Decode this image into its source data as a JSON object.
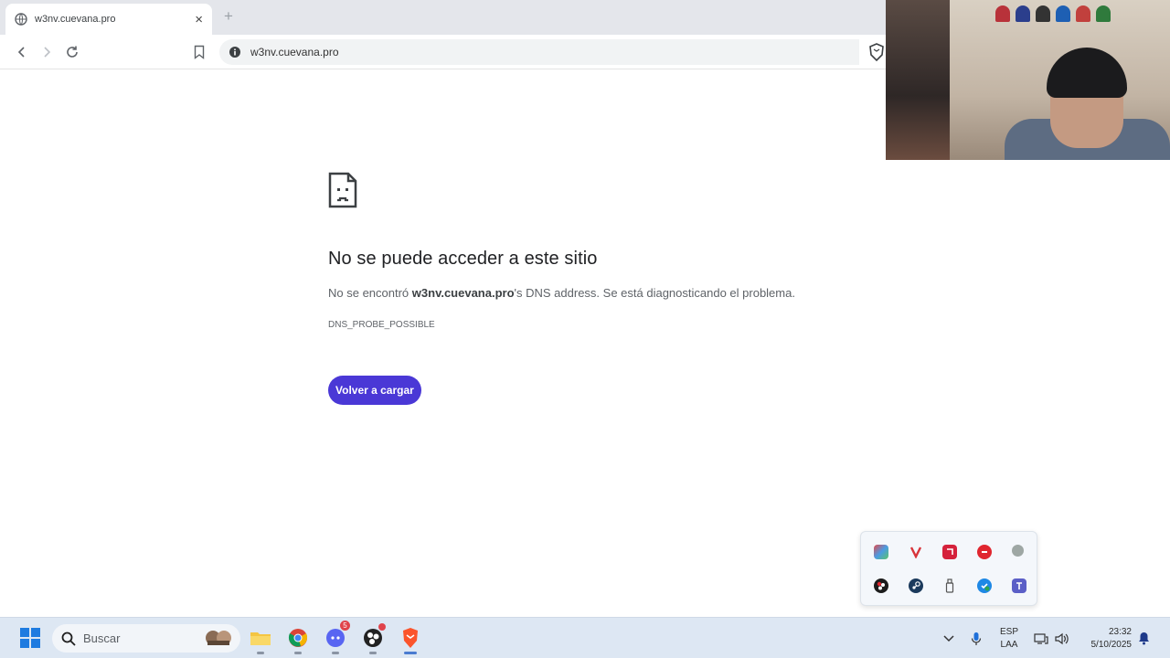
{
  "browser": {
    "tab": {
      "title": "w3nv.cuevana.pro",
      "close": "×"
    },
    "new_tab": "+",
    "address": {
      "url": "w3nv.cuevana.pro"
    }
  },
  "error_page": {
    "title": "No se puede acceder a este sitio",
    "desc_prefix": "No se encontró ",
    "desc_host": "w3nv.cuevana.pro",
    "desc_suffix": "'s DNS address. Se está diagnosticando el problema.",
    "code": "DNS_PROBE_POSSIBLE",
    "reload_label": "Volver a cargar"
  },
  "tray_popup": {
    "icons": [
      "nvidia-broadcast-icon",
      "vivaldi-icon",
      "amd-icon",
      "red-record-icon",
      "status-dot-icon",
      "obs-icon",
      "steam-icon",
      "usb-icon",
      "defender-icon",
      "teams-icon"
    ]
  },
  "taskbar": {
    "search_placeholder": "Buscar",
    "discord_badge": "5",
    "language_line1": "ESP",
    "language_line2": "LAA",
    "time": "23:32",
    "date": "5/10/2025"
  },
  "colors": {
    "accent_button": "#4a38d6",
    "taskbar": "#dde7f3",
    "tab_strip": "#e4e6eb"
  }
}
